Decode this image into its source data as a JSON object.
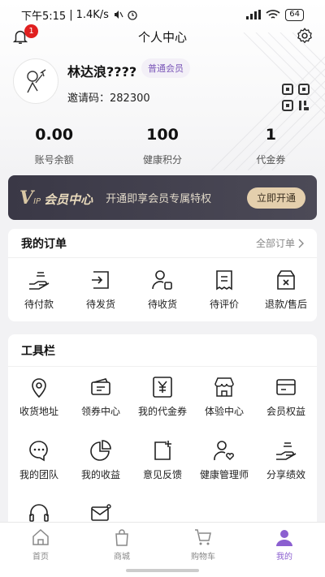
{
  "status_bar": {
    "time": "下午5:15",
    "speed": "1.4K/s",
    "battery": "64"
  },
  "header": {
    "title": "个人中心",
    "notification_count": "1"
  },
  "profile": {
    "name": "林达浪????",
    "member_level": "普通会员",
    "invite_code": "邀请码：282300"
  },
  "stats": [
    {
      "value": "0.00",
      "label": "账号余额"
    },
    {
      "value": "100",
      "label": "健康积分"
    },
    {
      "value": "1",
      "label": "代金券"
    }
  ],
  "vip": {
    "logo_v": "V",
    "logo_ip": "IP",
    "title": "会员中心",
    "desc": "开通即享会员专属特权",
    "button": "立即开通"
  },
  "orders": {
    "title": "我的订单",
    "more": "全部订单",
    "items": [
      {
        "label": "待付款",
        "icon": "pay-icon"
      },
      {
        "label": "待发货",
        "icon": "ship-icon"
      },
      {
        "label": "待收货",
        "icon": "receive-icon"
      },
      {
        "label": "待评价",
        "icon": "review-icon"
      },
      {
        "label": "退款/售后",
        "icon": "refund-icon"
      }
    ]
  },
  "tools": {
    "title": "工具栏",
    "items": [
      {
        "label": "收货地址",
        "icon": "location-icon"
      },
      {
        "label": "领券中心",
        "icon": "coupon-icon"
      },
      {
        "label": "我的代金券",
        "icon": "voucher-icon"
      },
      {
        "label": "体验中心",
        "icon": "store-icon"
      },
      {
        "label": "会员权益",
        "icon": "card-icon"
      },
      {
        "label": "我的团队",
        "icon": "team-icon"
      },
      {
        "label": "我的收益",
        "icon": "pie-icon"
      },
      {
        "label": "意见反馈",
        "icon": "feedback-icon"
      },
      {
        "label": "健康管理师",
        "icon": "health-manager-icon"
      },
      {
        "label": "分享绩效",
        "icon": "share-icon"
      },
      {
        "label": "",
        "icon": "headset-icon"
      },
      {
        "label": "",
        "icon": "mail-icon"
      }
    ]
  },
  "tabbar": [
    {
      "label": "首页",
      "icon": "home-icon"
    },
    {
      "label": "商城",
      "icon": "bag-icon"
    },
    {
      "label": "购物车",
      "icon": "cart-icon"
    },
    {
      "label": "我的",
      "icon": "user-icon"
    }
  ],
  "colors": {
    "accent": "#8b5fd0",
    "vip_bg": "#3a3846",
    "vip_gold": "#e4cfad",
    "badge": "#e02020"
  }
}
